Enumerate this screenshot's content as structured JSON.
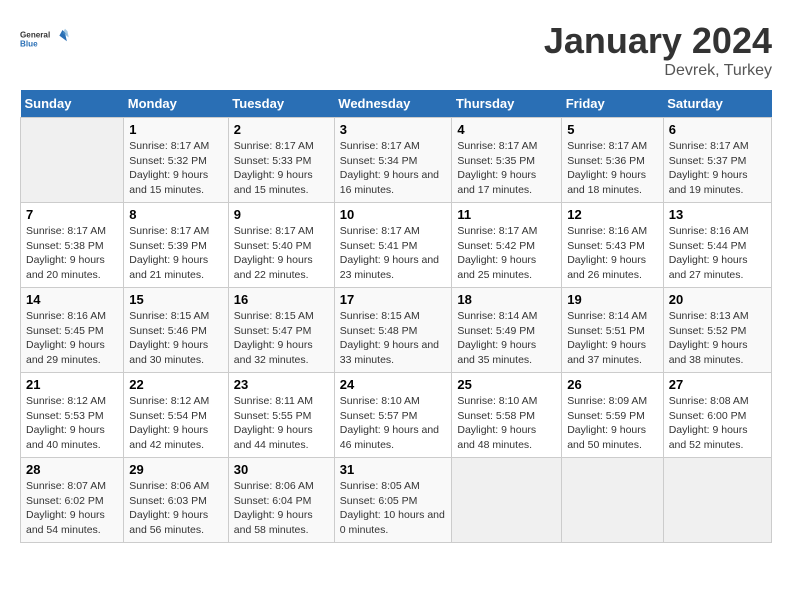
{
  "header": {
    "logo_general": "General",
    "logo_blue": "Blue",
    "title": "January 2024",
    "subtitle": "Devrek, Turkey"
  },
  "days_of_week": [
    "Sunday",
    "Monday",
    "Tuesday",
    "Wednesday",
    "Thursday",
    "Friday",
    "Saturday"
  ],
  "weeks": [
    [
      {
        "day": "",
        "sunrise": "",
        "sunset": "",
        "daylight": ""
      },
      {
        "day": "1",
        "sunrise": "Sunrise: 8:17 AM",
        "sunset": "Sunset: 5:32 PM",
        "daylight": "Daylight: 9 hours and 15 minutes."
      },
      {
        "day": "2",
        "sunrise": "Sunrise: 8:17 AM",
        "sunset": "Sunset: 5:33 PM",
        "daylight": "Daylight: 9 hours and 15 minutes."
      },
      {
        "day": "3",
        "sunrise": "Sunrise: 8:17 AM",
        "sunset": "Sunset: 5:34 PM",
        "daylight": "Daylight: 9 hours and 16 minutes."
      },
      {
        "day": "4",
        "sunrise": "Sunrise: 8:17 AM",
        "sunset": "Sunset: 5:35 PM",
        "daylight": "Daylight: 9 hours and 17 minutes."
      },
      {
        "day": "5",
        "sunrise": "Sunrise: 8:17 AM",
        "sunset": "Sunset: 5:36 PM",
        "daylight": "Daylight: 9 hours and 18 minutes."
      },
      {
        "day": "6",
        "sunrise": "Sunrise: 8:17 AM",
        "sunset": "Sunset: 5:37 PM",
        "daylight": "Daylight: 9 hours and 19 minutes."
      }
    ],
    [
      {
        "day": "7",
        "sunrise": "Sunrise: 8:17 AM",
        "sunset": "Sunset: 5:38 PM",
        "daylight": "Daylight: 9 hours and 20 minutes."
      },
      {
        "day": "8",
        "sunrise": "Sunrise: 8:17 AM",
        "sunset": "Sunset: 5:39 PM",
        "daylight": "Daylight: 9 hours and 21 minutes."
      },
      {
        "day": "9",
        "sunrise": "Sunrise: 8:17 AM",
        "sunset": "Sunset: 5:40 PM",
        "daylight": "Daylight: 9 hours and 22 minutes."
      },
      {
        "day": "10",
        "sunrise": "Sunrise: 8:17 AM",
        "sunset": "Sunset: 5:41 PM",
        "daylight": "Daylight: 9 hours and 23 minutes."
      },
      {
        "day": "11",
        "sunrise": "Sunrise: 8:17 AM",
        "sunset": "Sunset: 5:42 PM",
        "daylight": "Daylight: 9 hours and 25 minutes."
      },
      {
        "day": "12",
        "sunrise": "Sunrise: 8:16 AM",
        "sunset": "Sunset: 5:43 PM",
        "daylight": "Daylight: 9 hours and 26 minutes."
      },
      {
        "day": "13",
        "sunrise": "Sunrise: 8:16 AM",
        "sunset": "Sunset: 5:44 PM",
        "daylight": "Daylight: 9 hours and 27 minutes."
      }
    ],
    [
      {
        "day": "14",
        "sunrise": "Sunrise: 8:16 AM",
        "sunset": "Sunset: 5:45 PM",
        "daylight": "Daylight: 9 hours and 29 minutes."
      },
      {
        "day": "15",
        "sunrise": "Sunrise: 8:15 AM",
        "sunset": "Sunset: 5:46 PM",
        "daylight": "Daylight: 9 hours and 30 minutes."
      },
      {
        "day": "16",
        "sunrise": "Sunrise: 8:15 AM",
        "sunset": "Sunset: 5:47 PM",
        "daylight": "Daylight: 9 hours and 32 minutes."
      },
      {
        "day": "17",
        "sunrise": "Sunrise: 8:15 AM",
        "sunset": "Sunset: 5:48 PM",
        "daylight": "Daylight: 9 hours and 33 minutes."
      },
      {
        "day": "18",
        "sunrise": "Sunrise: 8:14 AM",
        "sunset": "Sunset: 5:49 PM",
        "daylight": "Daylight: 9 hours and 35 minutes."
      },
      {
        "day": "19",
        "sunrise": "Sunrise: 8:14 AM",
        "sunset": "Sunset: 5:51 PM",
        "daylight": "Daylight: 9 hours and 37 minutes."
      },
      {
        "day": "20",
        "sunrise": "Sunrise: 8:13 AM",
        "sunset": "Sunset: 5:52 PM",
        "daylight": "Daylight: 9 hours and 38 minutes."
      }
    ],
    [
      {
        "day": "21",
        "sunrise": "Sunrise: 8:12 AM",
        "sunset": "Sunset: 5:53 PM",
        "daylight": "Daylight: 9 hours and 40 minutes."
      },
      {
        "day": "22",
        "sunrise": "Sunrise: 8:12 AM",
        "sunset": "Sunset: 5:54 PM",
        "daylight": "Daylight: 9 hours and 42 minutes."
      },
      {
        "day": "23",
        "sunrise": "Sunrise: 8:11 AM",
        "sunset": "Sunset: 5:55 PM",
        "daylight": "Daylight: 9 hours and 44 minutes."
      },
      {
        "day": "24",
        "sunrise": "Sunrise: 8:10 AM",
        "sunset": "Sunset: 5:57 PM",
        "daylight": "Daylight: 9 hours and 46 minutes."
      },
      {
        "day": "25",
        "sunrise": "Sunrise: 8:10 AM",
        "sunset": "Sunset: 5:58 PM",
        "daylight": "Daylight: 9 hours and 48 minutes."
      },
      {
        "day": "26",
        "sunrise": "Sunrise: 8:09 AM",
        "sunset": "Sunset: 5:59 PM",
        "daylight": "Daylight: 9 hours and 50 minutes."
      },
      {
        "day": "27",
        "sunrise": "Sunrise: 8:08 AM",
        "sunset": "Sunset: 6:00 PM",
        "daylight": "Daylight: 9 hours and 52 minutes."
      }
    ],
    [
      {
        "day": "28",
        "sunrise": "Sunrise: 8:07 AM",
        "sunset": "Sunset: 6:02 PM",
        "daylight": "Daylight: 9 hours and 54 minutes."
      },
      {
        "day": "29",
        "sunrise": "Sunrise: 8:06 AM",
        "sunset": "Sunset: 6:03 PM",
        "daylight": "Daylight: 9 hours and 56 minutes."
      },
      {
        "day": "30",
        "sunrise": "Sunrise: 8:06 AM",
        "sunset": "Sunset: 6:04 PM",
        "daylight": "Daylight: 9 hours and 58 minutes."
      },
      {
        "day": "31",
        "sunrise": "Sunrise: 8:05 AM",
        "sunset": "Sunset: 6:05 PM",
        "daylight": "Daylight: 10 hours and 0 minutes."
      },
      {
        "day": "",
        "sunrise": "",
        "sunset": "",
        "daylight": ""
      },
      {
        "day": "",
        "sunrise": "",
        "sunset": "",
        "daylight": ""
      },
      {
        "day": "",
        "sunrise": "",
        "sunset": "",
        "daylight": ""
      }
    ]
  ]
}
